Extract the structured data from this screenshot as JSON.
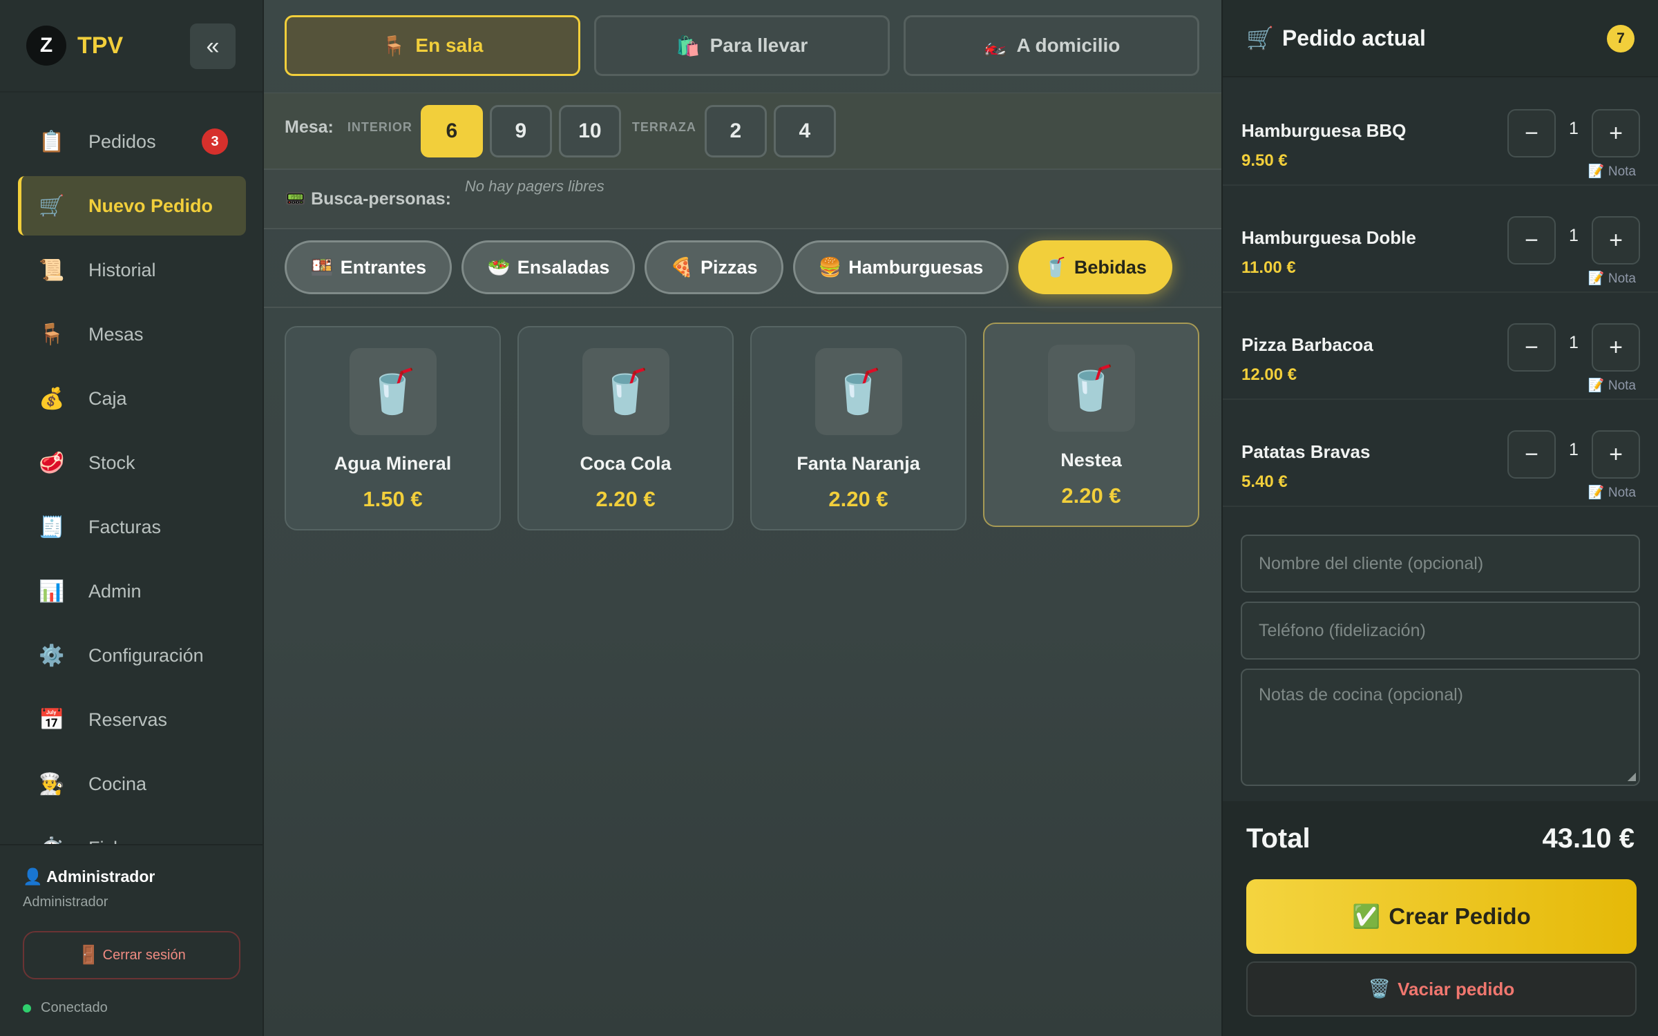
{
  "brand": {
    "logo_text": "Z",
    "name": "TPV",
    "collapse_label": "«"
  },
  "sidebar": {
    "items": [
      {
        "label": "Pedidos",
        "icon": "📋",
        "badge": "3"
      },
      {
        "label": "Nuevo Pedido",
        "icon": "🛒",
        "active": true
      },
      {
        "label": "Historial",
        "icon": "📜"
      },
      {
        "label": "Mesas",
        "icon": "🪑"
      },
      {
        "label": "Caja",
        "icon": "💰"
      },
      {
        "label": "Stock",
        "icon": "🥩"
      },
      {
        "label": "Facturas",
        "icon": "🧾"
      },
      {
        "label": "Admin",
        "icon": "📊"
      },
      {
        "label": "Configuración",
        "icon": "⚙️"
      },
      {
        "label": "Reservas",
        "icon": "📅"
      },
      {
        "label": "Cocina",
        "icon": "👨‍🍳"
      },
      {
        "label": "Fichar",
        "icon": "⏱️"
      }
    ]
  },
  "user": {
    "name": "👤 Administrador",
    "role": "Administrador",
    "logout_label": "Cerrar sesión",
    "logout_icon": "🚪",
    "status": "Conectado"
  },
  "order_types": [
    {
      "label": "En sala",
      "icon": "🪑",
      "active": true
    },
    {
      "label": "Para llevar",
      "icon": "🛍️"
    },
    {
      "label": "A domicilio",
      "icon": "🏍️"
    }
  ],
  "mesa": {
    "label": "Mesa:",
    "zones": [
      {
        "name": "INTERIOR",
        "tables": [
          "6",
          "9",
          "10"
        ]
      },
      {
        "name": "TERRAZA",
        "tables": [
          "2",
          "4"
        ]
      }
    ],
    "selected": "6"
  },
  "pager": {
    "label": "📟 Busca-personas:",
    "empty_text": "No hay pagers libres"
  },
  "categories": [
    {
      "label": "Entrantes",
      "icon": "🍱"
    },
    {
      "label": "Ensaladas",
      "icon": "🥗"
    },
    {
      "label": "Pizzas",
      "icon": "🍕"
    },
    {
      "label": "Hamburguesas",
      "icon": "🍔"
    },
    {
      "label": "Bebidas",
      "icon": "🥤",
      "active": true
    }
  ],
  "products": [
    {
      "name": "Agua Mineral",
      "price": "1.50 €",
      "icon": "🥤"
    },
    {
      "name": "Coca Cola",
      "price": "2.20 €",
      "icon": "🥤"
    },
    {
      "name": "Fanta Naranja",
      "price": "2.20 €",
      "icon": "🥤"
    },
    {
      "name": "Nestea",
      "price": "2.20 €",
      "icon": "🥤",
      "hover": true
    }
  ],
  "order": {
    "title": "Pedido actual",
    "title_icon": "🛒",
    "count": "7",
    "items": [
      {
        "name": "Hamburguesa BBQ",
        "price": "9.50 €",
        "qty": "1"
      },
      {
        "name": "Hamburguesa Doble",
        "price": "11.00 €",
        "qty": "1"
      },
      {
        "name": "Pizza Barbacoa",
        "price": "12.00 €",
        "qty": "1"
      },
      {
        "name": "Patatas Bravas",
        "price": "5.40 €",
        "qty": "1"
      }
    ],
    "minus_label": "−",
    "plus_label": "+",
    "note_label": "📝 Nota",
    "customer_placeholder": "Nombre del cliente (opcional)",
    "phone_placeholder": "Teléfono (fidelización)",
    "notes_placeholder": "Notas de cocina (opcional)",
    "total_label": "Total",
    "total_value": "43.10 €",
    "create_label": "Crear Pedido",
    "create_icon": "✅",
    "clear_label": "Vaciar pedido",
    "clear_icon": "🗑️"
  },
  "colors": {
    "accent": "#f2cf3b",
    "danger": "#d6302c",
    "online": "#2fcf6d"
  }
}
